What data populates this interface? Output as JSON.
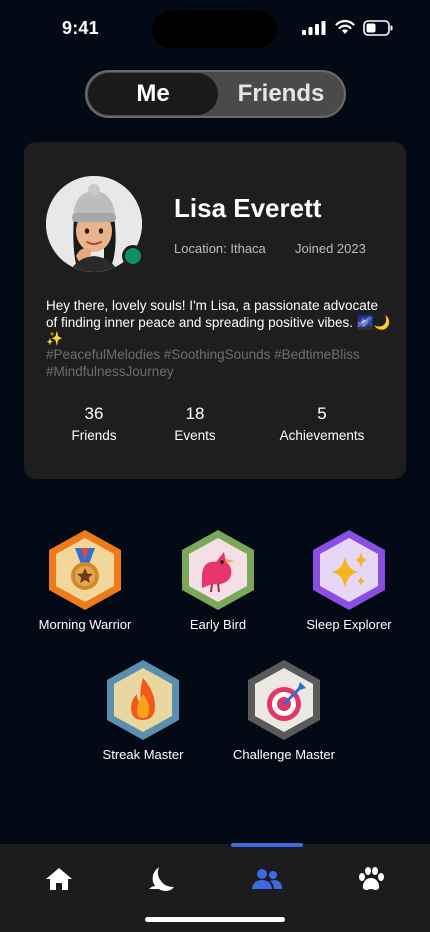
{
  "status_bar": {
    "time": "9:41"
  },
  "toggle": {
    "me_label": "Me",
    "friends_label": "Friends",
    "selected": "Me"
  },
  "profile": {
    "name": "Lisa Everett",
    "location": "Location: Ithaca",
    "joined": "Joined 2023",
    "bio": "Hey there, lovely souls! I'm Lisa, a passionate advocate of finding inner peace and spreading positive vibes. 🌌🌙✨",
    "tags": "#PeacefulMelodies #SoothingSounds #BedtimeBliss #MindfulnessJourney",
    "status_color": "#0e8f6a",
    "stats": [
      {
        "value": "36",
        "label": "Friends"
      },
      {
        "value": "18",
        "label": "Events"
      },
      {
        "value": "5",
        "label": "Achievements"
      }
    ]
  },
  "achievements": [
    {
      "label": "Morning Warrior",
      "icon": "medal-icon",
      "color": "#f07a1a"
    },
    {
      "label": "Early Bird",
      "icon": "bird-icon",
      "color": "#7aa85a"
    },
    {
      "label": "Sleep Explorer",
      "icon": "sparkles-icon",
      "color": "#8a4fe0"
    },
    {
      "label": "Streak Master",
      "icon": "fire-icon",
      "color": "#5a8fb0"
    },
    {
      "label": "Challenge Master",
      "icon": "target-icon",
      "color": "#5a5a5a"
    }
  ],
  "nav": {
    "items": [
      {
        "name": "home",
        "icon": "home-icon"
      },
      {
        "name": "sleep",
        "icon": "moon-icon"
      },
      {
        "name": "friends",
        "icon": "people-icon",
        "active": true
      },
      {
        "name": "pets",
        "icon": "paw-icon"
      }
    ],
    "active_color": "#3d6ae0"
  }
}
